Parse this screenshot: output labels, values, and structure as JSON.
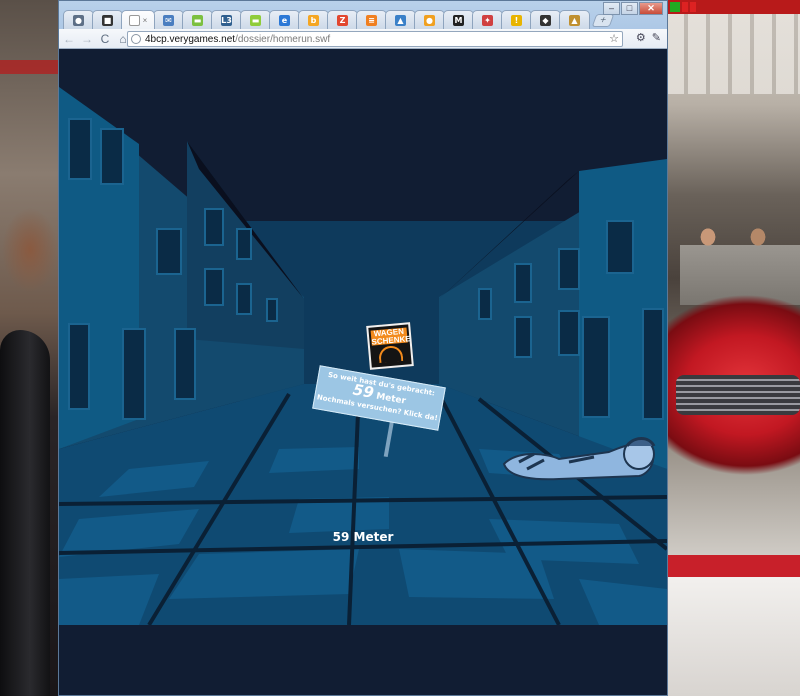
{
  "taskbar": {
    "items": [
      "",
      "",
      ""
    ]
  },
  "browser": {
    "tabs": [
      {
        "icon": "pin-icon",
        "glyph": "●",
        "color": "#5d6f86"
      },
      {
        "icon": "app-icon",
        "glyph": "■",
        "color": "#333333"
      },
      {
        "icon": "page-icon",
        "glyph": "",
        "color": "#ffffff",
        "active": true
      },
      {
        "icon": "mail-icon",
        "glyph": "✉",
        "color": "#4a7ec0"
      },
      {
        "icon": "chat-icon",
        "glyph": "▬",
        "color": "#7cc040"
      },
      {
        "icon": "l3-icon",
        "glyph": "L3",
        "color": "#2f5f8f"
      },
      {
        "icon": "speech-icon",
        "glyph": "▬",
        "color": "#8fcc3a"
      },
      {
        "icon": "ie-icon",
        "glyph": "e",
        "color": "#2b78d6"
      },
      {
        "icon": "orange-icon",
        "glyph": "b",
        "color": "#f5a623"
      },
      {
        "icon": "z-icon",
        "glyph": "Z",
        "color": "#e2472f"
      },
      {
        "icon": "stack-icon",
        "glyph": "≡",
        "color": "#f07f20"
      },
      {
        "icon": "photo-icon",
        "glyph": "▲",
        "color": "#3a80c8"
      },
      {
        "icon": "soccer-icon",
        "glyph": "●",
        "color": "#f0a020"
      },
      {
        "icon": "m-icon",
        "glyph": "M",
        "color": "#222222"
      },
      {
        "icon": "rocket-icon",
        "glyph": "✦",
        "color": "#d04040"
      },
      {
        "icon": "warning-icon",
        "glyph": "!",
        "color": "#e8b400"
      },
      {
        "icon": "bird-icon",
        "glyph": "◆",
        "color": "#333333"
      },
      {
        "icon": "castle-icon",
        "glyph": "▲",
        "color": "#c09030"
      }
    ],
    "tab_close": "×",
    "new_tab": "+",
    "window_controls": {
      "minimize": "–",
      "restore": "□",
      "close": "✕"
    },
    "nav": {
      "back": "←",
      "forward": "→",
      "reload": "C",
      "home": "⌂"
    },
    "url": {
      "host": "4bcp.verygames.net",
      "path": "/dossier/homerun.swf"
    },
    "bookmark_star": "☆",
    "tools": {
      "extensions": "⚙",
      "wrench": "✎"
    }
  },
  "game": {
    "logo": {
      "line1": "WAGEN",
      "line2": "SCHENKE"
    },
    "sign": {
      "line1": "So weit hast du's gebracht:",
      "distance_value": "59",
      "distance_unit": "Meter",
      "line3": "Nochmals versuchen? Klick da!"
    },
    "distance_label": "59 Meter"
  }
}
